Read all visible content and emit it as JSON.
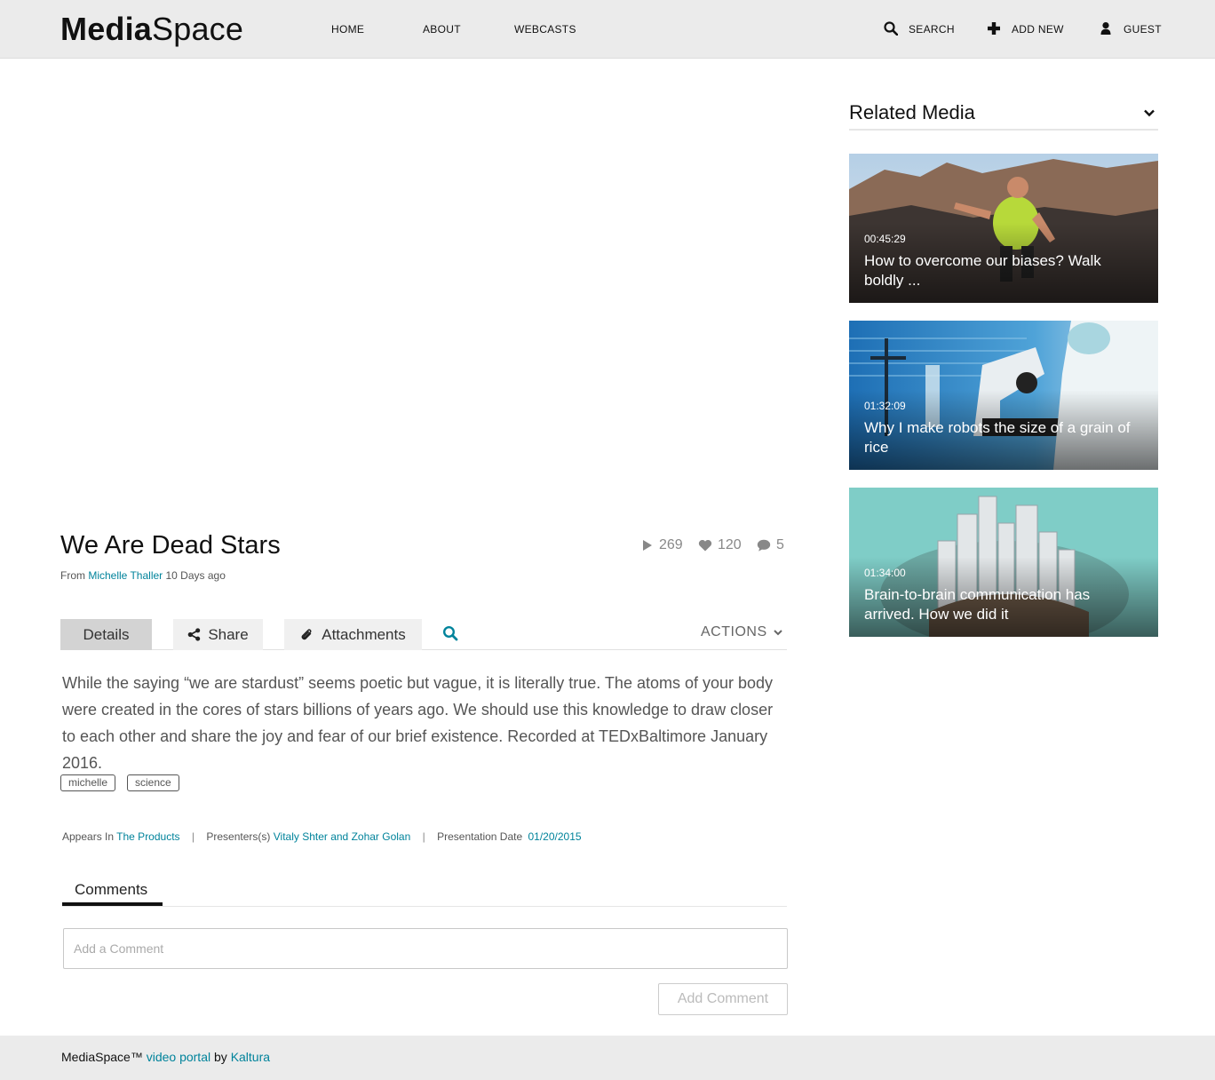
{
  "header": {
    "logo_bold": "Media",
    "logo_light": "Space",
    "nav": [
      "HOME",
      "ABOUT",
      "WEBCASTS"
    ],
    "search_label": "SEARCH",
    "add_new_label": "ADD NEW",
    "guest_label": "GUEST"
  },
  "media": {
    "title": "We Are Dead Stars",
    "from_label": "From",
    "author": "Michelle Thaller",
    "age": "10 Days ago",
    "plays": "269",
    "likes": "120",
    "comments_count": "5"
  },
  "tabs": {
    "details": "Details",
    "share": "Share",
    "attachments": "Attachments",
    "actions": "ACTIONS"
  },
  "description": "While the saying “we are stardust” seems poetic but vague, it is literally true. The atoms of your body were created in the cores of stars billions of years ago. We should use this knowledge to draw closer to each other and share the joy and fear of our brief existence. Recorded at TEDxBaltimore January 2016.",
  "tags": [
    "michelle",
    "science"
  ],
  "details": {
    "appears_in_label": "Appears In",
    "appears_in_value": "The Products",
    "presenters_label": "Presenters(s)",
    "presenters_value": "Vitaly Shter and Zohar Golan",
    "date_label": "Presentation Date",
    "date_value": "01/20/2015",
    "separator": "|"
  },
  "comments": {
    "tab_label": "Comments",
    "placeholder": "Add a Comment",
    "button_label": "Add Comment"
  },
  "related": {
    "title": "Related Media",
    "items": [
      {
        "duration": "00:45:29",
        "title": "How to overcome our biases? Walk boldly ..."
      },
      {
        "duration": "01:32:09",
        "title": "Why I make robots the size of a grain of rice"
      },
      {
        "duration": "01:34:00",
        "title": "Brain-to-brain communication has arrived. How we did it"
      }
    ]
  },
  "footer": {
    "brand": "MediaSpace™",
    "link1": "video portal",
    "by": "by",
    "link2": "Kaltura"
  },
  "colors": {
    "accent": "#00839b",
    "header_bg": "#ebebeb",
    "active_tab": "#d3d3d3"
  }
}
